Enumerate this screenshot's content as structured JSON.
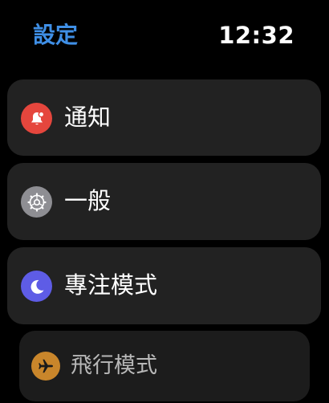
{
  "header": {
    "back_title": "設定",
    "time": "12:32"
  },
  "menu": {
    "items": [
      {
        "label": "通知",
        "icon": "bell-icon",
        "color": "#e5463d"
      },
      {
        "label": "一般",
        "icon": "gear-icon",
        "color": "#8e8e93"
      },
      {
        "label": "專注模式",
        "icon": "moon-icon",
        "color": "#5e5ce6"
      },
      {
        "label": "飛行模式",
        "icon": "airplane-icon",
        "color": "#c9862b"
      }
    ]
  },
  "colors": {
    "accent": "#3f8fe6",
    "background": "#000000",
    "row_background": "#222222"
  }
}
